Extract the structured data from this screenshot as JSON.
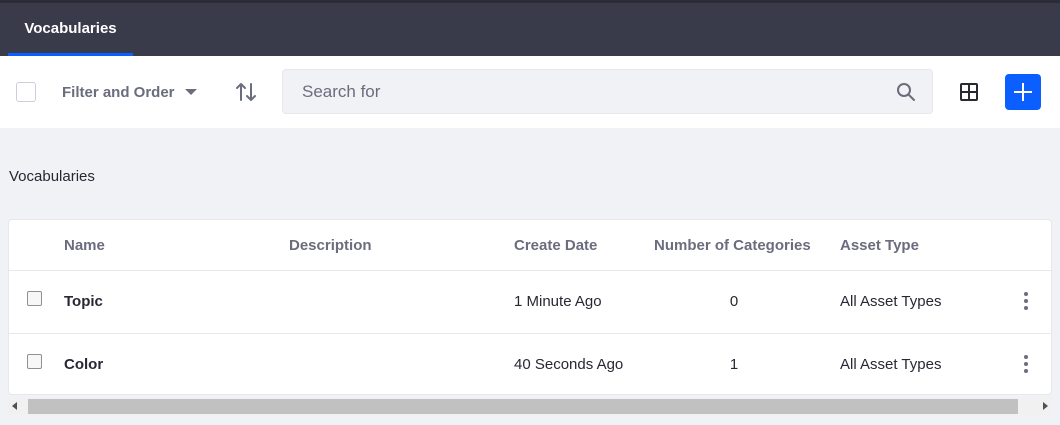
{
  "nav": {
    "tab_label": "Vocabularies"
  },
  "toolbar": {
    "filter_label": "Filter and Order",
    "search_placeholder": "Search for",
    "sort_icon": "sort-icon",
    "view_icon": "grid-view-icon",
    "add_icon": "plus-icon"
  },
  "section": {
    "title": "Vocabularies"
  },
  "table": {
    "columns": [
      "Name",
      "Description",
      "Create Date",
      "Number of Categories",
      "Asset Type"
    ],
    "rows": [
      {
        "name": "Topic",
        "description": "",
        "create_date": "1 Minute Ago",
        "categories": "0",
        "asset_type": "All Asset Types"
      },
      {
        "name": "Color",
        "description": "",
        "create_date": "40 Seconds Ago",
        "categories": "1",
        "asset_type": "All Asset Types"
      }
    ]
  },
  "colors": {
    "nav_bg": "#393a4a",
    "accent": "#0b5fff",
    "page_bg": "#f1f2f5"
  }
}
